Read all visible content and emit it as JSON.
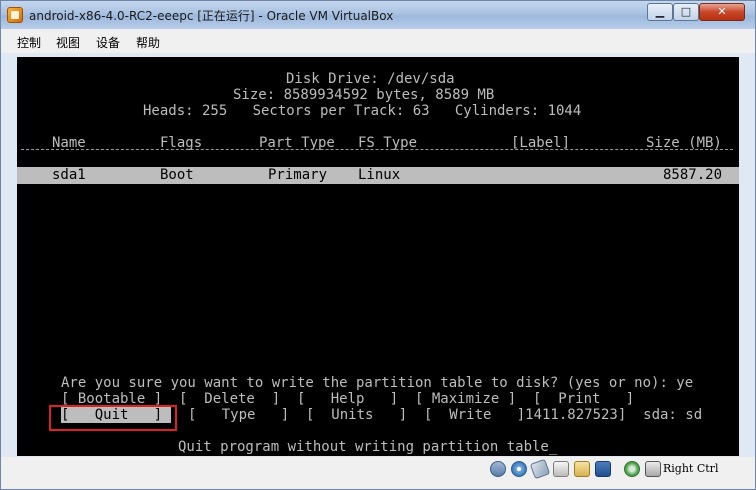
{
  "window": {
    "title": "android-x86-4.0-RC2-eeepc [正在运行] - Oracle VM VirtualBox",
    "min_label": "▁",
    "max_label": "□",
    "close_label": "✕"
  },
  "menu": [
    "控制",
    "视图",
    "设备",
    "帮助"
  ],
  "screen": {
    "disk_line": "Disk Drive: /dev/sda",
    "size_line": "Size: 8589934592 bytes, 8589 MB",
    "geometry_line": "Heads: 255   Sectors per Track: 63   Cylinders: 1044",
    "columns": [
      "Name",
      "Flags",
      "Part Type",
      "FS Type",
      "[Label]",
      "Size (MB)"
    ],
    "partition": {
      "name": "sda1",
      "flags": "Boot",
      "part_type": "Primary",
      "fs_type": "Linux",
      "label": "",
      "size": "8587.20"
    },
    "prompt": "Are you sure you want to write the partition table to disk? (yes or no): ye",
    "menu_row1": "[ Bootable ]  [  Delete  ]  [   Help   ]  [ Maximize ]  [  Print   ]",
    "quit_label": "[   Quit   ]",
    "menu_row2_rest": "[   Type   ]  [  Units   ]  [  Write   ]1411.827523]  sda: sd",
    "status_line": "Quit program without writing partition table_"
  },
  "statusbar": {
    "icons": [
      "hdd-icon",
      "cd-icon",
      "usb-icon",
      "network-icon",
      "shared-folder-icon",
      "display-icon",
      "mouse-integration-icon",
      "host-key-icon"
    ],
    "host_key": "Right Ctrl"
  }
}
